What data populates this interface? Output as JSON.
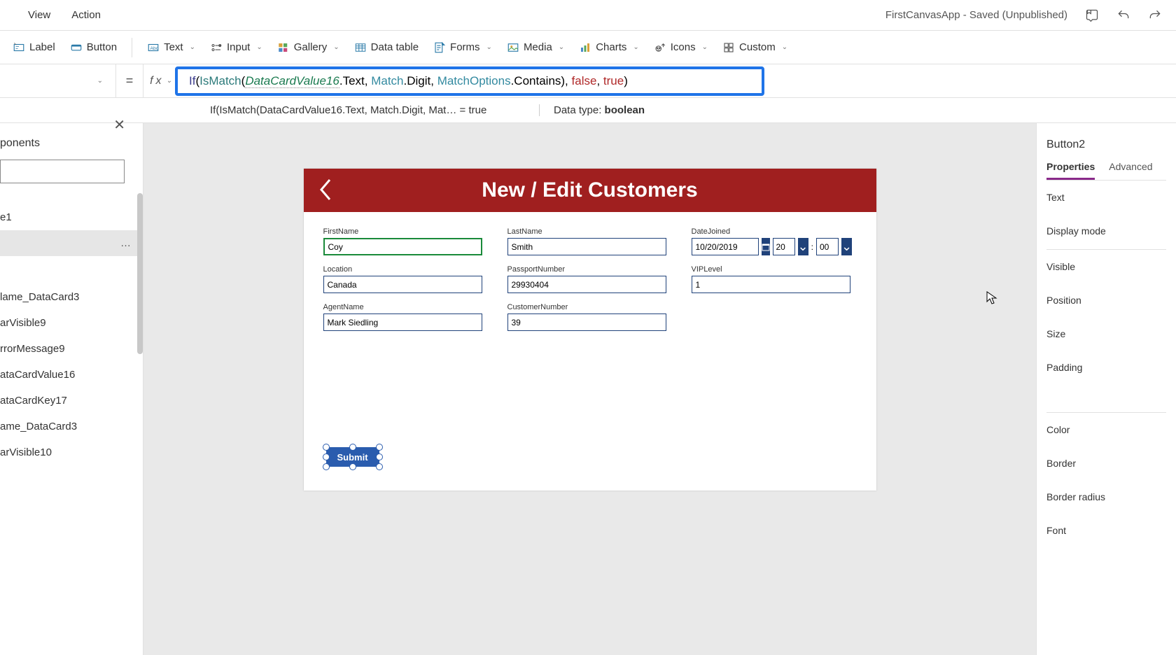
{
  "topmenu": {
    "view": "View",
    "action": "Action",
    "status": "FirstCanvasApp - Saved (Unpublished)"
  },
  "ribbon": {
    "label": "Label",
    "button": "Button",
    "text": "Text",
    "input": "Input",
    "gallery": "Gallery",
    "datatable": "Data table",
    "forms": "Forms",
    "media": "Media",
    "charts": "Charts",
    "icons": "Icons",
    "custom": "Custom"
  },
  "formula": {
    "kw_if": "If",
    "p1": "(",
    "kw_ismatch": "IsMatch",
    "p2": "(",
    "id": "DataCardValue16",
    "prop_text": ".Text, ",
    "enum_match": "Match",
    "digit": ".Digit, ",
    "enum_opts": "MatchOptions",
    "contains": ".Contains), ",
    "val_false": "false",
    "comma": ", ",
    "val_true": "true",
    "p3": ")"
  },
  "result": {
    "expr": "If(IsMatch(DataCardValue16.Text, Match.Digit, Mat…   =   true",
    "type_label": "Data type: ",
    "type_value": "boolean"
  },
  "left": {
    "heading": "ponents",
    "item1": "e1",
    "tree": [
      "lame_DataCard3",
      "arVisible9",
      "rrorMessage9",
      "ataCardValue16",
      "ataCardKey17",
      "ame_DataCard3",
      "arVisible10"
    ]
  },
  "app": {
    "title": "New / Edit Customers",
    "firstname_label": "FirstName",
    "firstname": "Coy",
    "lastname_label": "LastName",
    "lastname": "Smith",
    "datejoined_label": "DateJoined",
    "datejoined": "10/20/2019",
    "hour": "20",
    "minute": "00",
    "location_label": "Location",
    "location": "Canada",
    "passport_label": "PassportNumber",
    "passport": "29930404",
    "vip_label": "VIPLevel",
    "vip": "1",
    "agent_label": "AgentName",
    "agent": "Mark Siedling",
    "custnum_label": "CustomerNumber",
    "custnum": "39",
    "submit": "Submit"
  },
  "props": {
    "title": "Button2",
    "tab_props": "Properties",
    "tab_adv": "Advanced",
    "r_text": "Text",
    "r_display": "Display mode",
    "r_visible": "Visible",
    "r_position": "Position",
    "r_size": "Size",
    "r_padding": "Padding",
    "r_color": "Color",
    "r_border": "Border",
    "r_radius": "Border radius",
    "r_font": "Font"
  }
}
